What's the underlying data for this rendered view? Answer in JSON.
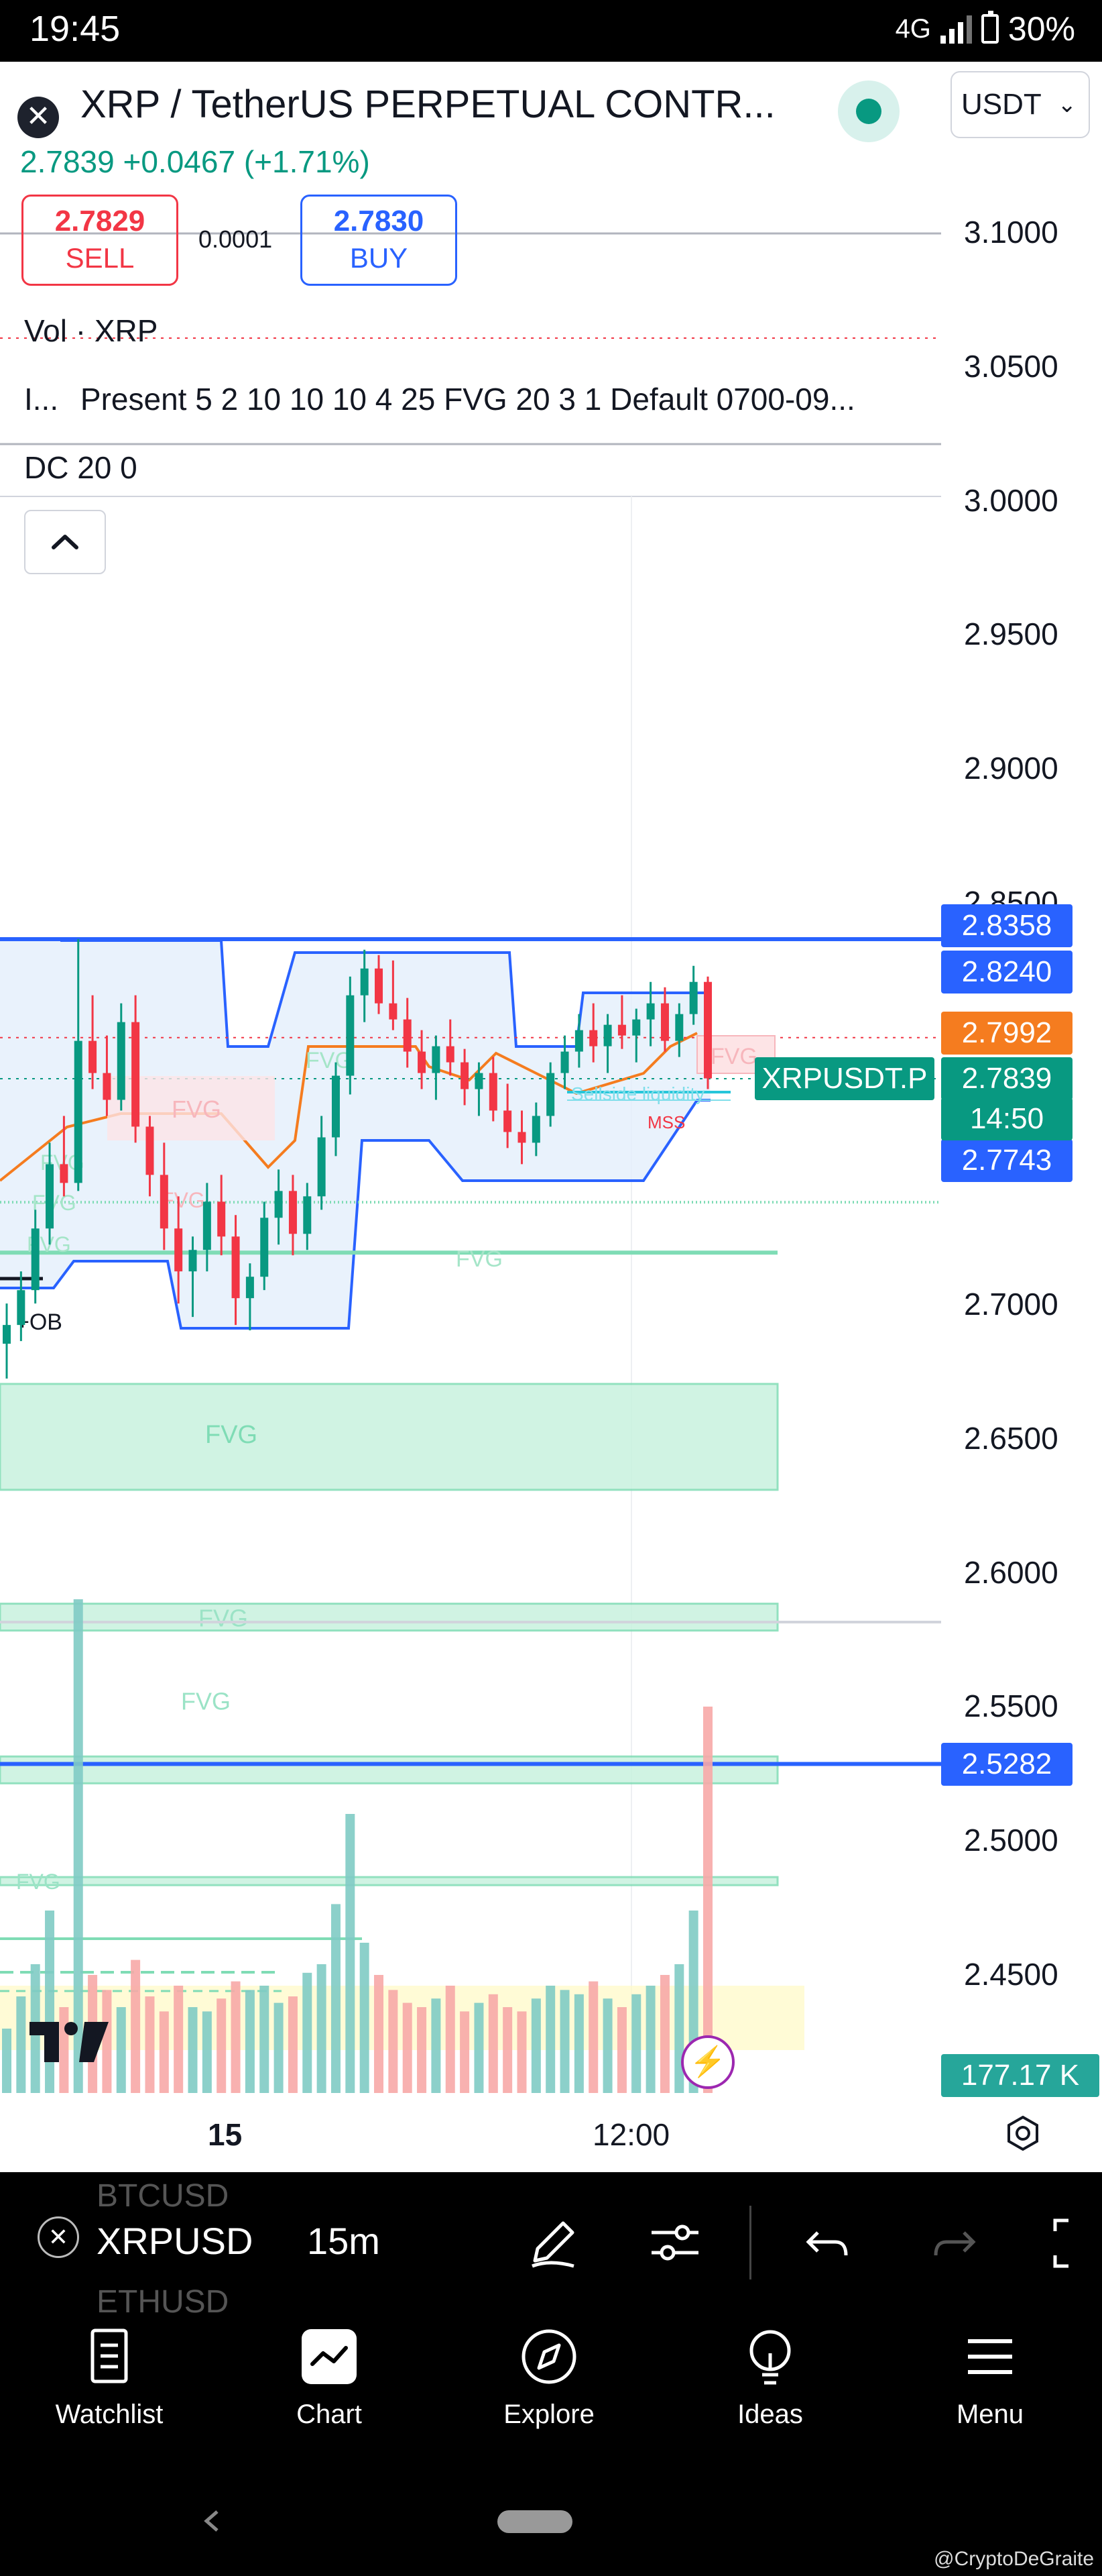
{
  "status_bar": {
    "time": "19:45",
    "network": "4G",
    "battery": "30%"
  },
  "header": {
    "close_icon": "close-icon",
    "symbol_title": "XRP / TetherUS PERPETUAL CONTR...",
    "currency": "USDT",
    "last_price": "2.7839",
    "change": "+0.0467",
    "change_pct": "(+1.71%)"
  },
  "trade": {
    "sell_price": "2.7829",
    "sell_label": "SELL",
    "spread": "0.0001",
    "buy_price": "2.7830",
    "buy_label": "BUY"
  },
  "legends": {
    "volume": "Vol · XRP",
    "indicator_prefix": "I...",
    "indicator": "Present 5 2 10 10 10 4 25 FVG 20 3 1 Default 0700-09...",
    "donchian": "DC 20 0"
  },
  "price_axis": {
    "ticks": [
      "3.1000",
      "3.0500",
      "3.0000",
      "2.9500",
      "2.9000",
      "2.8500",
      "2.7000",
      "2.6500",
      "2.6000",
      "2.5500",
      "2.5000",
      "2.4500"
    ],
    "tags": [
      {
        "value": "2.8358",
        "color": "#2962ff"
      },
      {
        "value": "2.8240",
        "color": "#2962ff"
      },
      {
        "value": "2.7992",
        "color": "#f57c1f"
      },
      {
        "value": "2.7839",
        "color": "#089981"
      },
      {
        "value": "2.7743",
        "color": "#2962ff"
      },
      {
        "value": "2.5282",
        "color": "#2962ff"
      }
    ],
    "countdown": "14:50",
    "symbol_tag": "XRPUSDT.P",
    "volume_tag": "177.17 K"
  },
  "chart_annotations": {
    "fvg": "FVG",
    "ob": "+OB",
    "mss": "MSS",
    "liquidity": "Sellside liquidity"
  },
  "time_axis": {
    "ticks": [
      "15",
      "12:00"
    ]
  },
  "toolbar": {
    "symbol": "XRPUSD",
    "interval": "15m",
    "ghost_above": "BTCUSD",
    "ghost_below": "ETHUSD"
  },
  "nav": [
    {
      "label": "Watchlist",
      "icon": "watchlist-icon"
    },
    {
      "label": "Chart",
      "icon": "chart-icon"
    },
    {
      "label": "Explore",
      "icon": "compass-icon"
    },
    {
      "label": "Ideas",
      "icon": "lightbulb-icon"
    },
    {
      "label": "Menu",
      "icon": "menu-icon"
    }
  ],
  "watermark": "@CryptoDeGraite",
  "chart_data": {
    "type": "candlestick",
    "ylim": [
      2.42,
      3.11
    ],
    "price_ticks": [
      3.1,
      3.05,
      3.0,
      2.95,
      2.9,
      2.85,
      2.7,
      2.65,
      2.6,
      2.55,
      2.5,
      2.45
    ],
    "last": 2.7839,
    "donchian_upper": 2.8358,
    "donchian_upper_recent": 2.824,
    "donchian_lower_recent": 2.7743,
    "donchian_mid": 2.7992,
    "support_line": 2.5282,
    "candles": [
      [
        2.685,
        2.7,
        2.672,
        2.692
      ],
      [
        2.692,
        2.712,
        2.686,
        2.705
      ],
      [
        2.705,
        2.735,
        2.7,
        2.728
      ],
      [
        2.728,
        2.76,
        2.722,
        2.752
      ],
      [
        2.752,
        2.77,
        2.74,
        2.745
      ],
      [
        2.745,
        2.836,
        2.742,
        2.798
      ],
      [
        2.798,
        2.815,
        2.78,
        2.786
      ],
      [
        2.786,
        2.8,
        2.77,
        2.776
      ],
      [
        2.776,
        2.812,
        2.772,
        2.805
      ],
      [
        2.805,
        2.815,
        2.76,
        2.766
      ],
      [
        2.766,
        2.77,
        2.74,
        2.748
      ],
      [
        2.748,
        2.76,
        2.72,
        2.728
      ],
      [
        2.728,
        2.74,
        2.7,
        2.712
      ],
      [
        2.712,
        2.725,
        2.695,
        2.72
      ],
      [
        2.72,
        2.745,
        2.712,
        2.738
      ],
      [
        2.738,
        2.748,
        2.718,
        2.725
      ],
      [
        2.725,
        2.733,
        2.692,
        2.702
      ],
      [
        2.702,
        2.715,
        2.69,
        2.71
      ],
      [
        2.71,
        2.738,
        2.705,
        2.732
      ],
      [
        2.732,
        2.75,
        2.722,
        2.742
      ],
      [
        2.742,
        2.748,
        2.718,
        2.726
      ],
      [
        2.726,
        2.745,
        2.72,
        2.74
      ],
      [
        2.74,
        2.77,
        2.735,
        2.762
      ],
      [
        2.762,
        2.79,
        2.755,
        2.785
      ],
      [
        2.785,
        2.822,
        2.778,
        2.815
      ],
      [
        2.815,
        2.832,
        2.805,
        2.825
      ],
      [
        2.825,
        2.83,
        2.808,
        2.812
      ],
      [
        2.812,
        2.828,
        2.802,
        2.806
      ],
      [
        2.806,
        2.814,
        2.788,
        2.794
      ],
      [
        2.794,
        2.802,
        2.78,
        2.786
      ],
      [
        2.786,
        2.8,
        2.776,
        2.796
      ],
      [
        2.796,
        2.806,
        2.785,
        2.79
      ],
      [
        2.79,
        2.795,
        2.774,
        2.78
      ],
      [
        2.78,
        2.79,
        2.77,
        2.786
      ],
      [
        2.786,
        2.792,
        2.768,
        2.772
      ],
      [
        2.772,
        2.782,
        2.758,
        2.764
      ],
      [
        2.764,
        2.772,
        2.752,
        2.76
      ],
      [
        2.76,
        2.775,
        2.755,
        2.77
      ],
      [
        2.77,
        2.79,
        2.766,
        2.786
      ],
      [
        2.786,
        2.8,
        2.78,
        2.794
      ],
      [
        2.794,
        2.808,
        2.788,
        2.802
      ],
      [
        2.802,
        2.812,
        2.79,
        2.796
      ],
      [
        2.796,
        2.808,
        2.786,
        2.804
      ],
      [
        2.804,
        2.815,
        2.795,
        2.8
      ],
      [
        2.8,
        2.81,
        2.79,
        2.806
      ],
      [
        2.806,
        2.82,
        2.796,
        2.812
      ],
      [
        2.812,
        2.818,
        2.794,
        2.798
      ],
      [
        2.798,
        2.812,
        2.792,
        2.808
      ],
      [
        2.808,
        2.826,
        2.804,
        2.82
      ],
      [
        2.82,
        2.822,
        2.78,
        2.784
      ]
    ],
    "volumes": [
      30,
      45,
      60,
      85,
      40,
      230,
      55,
      48,
      40,
      62,
      45,
      38,
      50,
      40,
      38,
      44,
      52,
      48,
      50,
      42,
      45,
      56,
      60,
      88,
      130,
      70,
      55,
      48,
      42,
      40,
      44,
      50,
      38,
      42,
      46,
      40,
      38,
      44,
      50,
      48,
      46,
      52,
      44,
      40,
      46,
      50,
      55,
      60,
      85,
      180
    ]
  }
}
